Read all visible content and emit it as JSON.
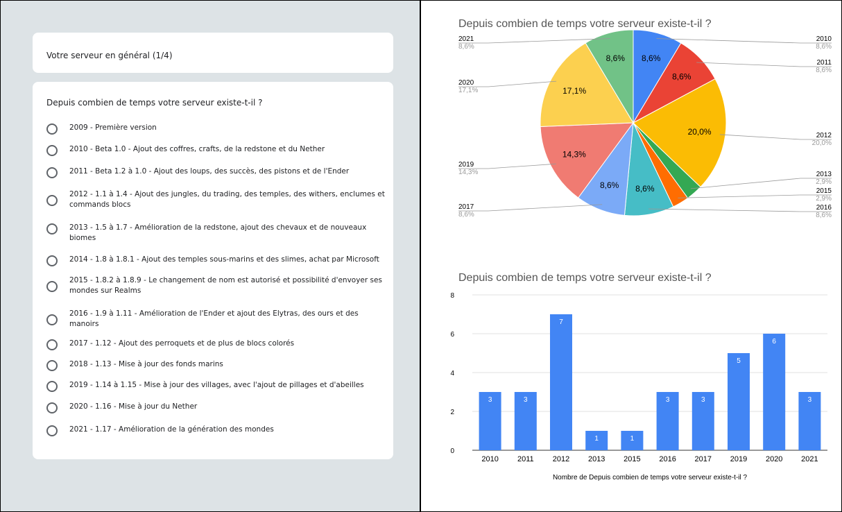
{
  "form": {
    "section_title": "Votre serveur en général (1/4)",
    "question": "Depuis combien de temps votre serveur existe-t-il ?",
    "options": [
      {
        "label": "2009 - Première version",
        "selected": false
      },
      {
        "label": "2010 - Beta 1.0 - Ajout des coffres, crafts, de la redstone et du Nether",
        "selected": false
      },
      {
        "label": "2011 - Beta 1.2 à 1.0 - Ajout des loups, des succès, des pistons et de l'Ender",
        "selected": false
      },
      {
        "label": "2012 - 1.1 à 1.4 - Ajout des jungles, du trading, des temples, des withers, enclumes et commands blocs",
        "selected": false
      },
      {
        "label": "2013 - 1.5 à 1.7 - Amélioration de la redstone, ajout des chevaux et de nouveaux biomes",
        "selected": false
      },
      {
        "label": "2014 - 1.8 à 1.8.1 - Ajout des temples sous-marins et des slimes, achat par Microsoft",
        "selected": false
      },
      {
        "label": "2015 - 1.8.2 à 1.8.9 - Le changement de nom est autorisé et possibilité d'envoyer ses mondes sur Realms",
        "selected": false
      },
      {
        "label": "2016 - 1.9 à 1.11 - Amélioration de l'Ender et ajout des Elytras, des ours et des manoirs",
        "selected": false
      },
      {
        "label": "2017 - 1.12 - Ajout des perroquets et de plus de blocs colorés",
        "selected": false
      },
      {
        "label": "2018 - 1.13 - Mise à jour des fonds marins",
        "selected": false
      },
      {
        "label": "2019 - 1.14 à 1.15 - Mise à jour des villages, avec l'ajout de pillages et d'abeilles",
        "selected": false
      },
      {
        "label": "2020 - 1.16 - Mise à jour du Nether",
        "selected": false
      },
      {
        "label": "2021 - 1.17 - Amélioration de la génération des mondes",
        "selected": false
      }
    ]
  },
  "chart_data": [
    {
      "type": "pie",
      "title": "Depuis combien de temps votre serveur existe-t-il ?",
      "slices": [
        {
          "label": "2010",
          "value": 8.6,
          "display": "8,6%",
          "color": "#4285f4"
        },
        {
          "label": "2011",
          "value": 8.6,
          "display": "8,6%",
          "color": "#ea4335"
        },
        {
          "label": "2012",
          "value": 20.0,
          "display": "20,0%",
          "color": "#fbbc04"
        },
        {
          "label": "2013",
          "value": 2.9,
          "display": "2,9%",
          "color": "#34a853"
        },
        {
          "label": "2015",
          "value": 2.9,
          "display": "2,9%",
          "color": "#ff6d01"
        },
        {
          "label": "2016",
          "value": 8.6,
          "display": "8,6%",
          "color": "#46bdc6"
        },
        {
          "label": "2017",
          "value": 8.6,
          "display": "8,6%",
          "color": "#7baaf7"
        },
        {
          "label": "2019",
          "value": 14.3,
          "display": "14,3%",
          "color": "#f07b72"
        },
        {
          "label": "2020",
          "value": 17.1,
          "display": "17,1%",
          "color": "#fcd04f"
        },
        {
          "label": "2021",
          "value": 8.6,
          "display": "8,6%",
          "color": "#71c287"
        }
      ]
    },
    {
      "type": "bar",
      "title": "Depuis combien de temps votre serveur existe-t-il ?",
      "xlabel": "Nombre de Depuis combien de temps votre serveur existe-t-il ?",
      "categories": [
        "2010",
        "2011",
        "2012",
        "2013",
        "2015",
        "2016",
        "2017",
        "2019",
        "2020",
        "2021"
      ],
      "values": [
        3,
        3,
        7,
        1,
        1,
        3,
        3,
        5,
        6,
        3
      ],
      "ylim": [
        0,
        8
      ],
      "yticks": [
        0,
        2,
        4,
        6,
        8
      ],
      "color": "#4285f4",
      "grid": true
    }
  ]
}
